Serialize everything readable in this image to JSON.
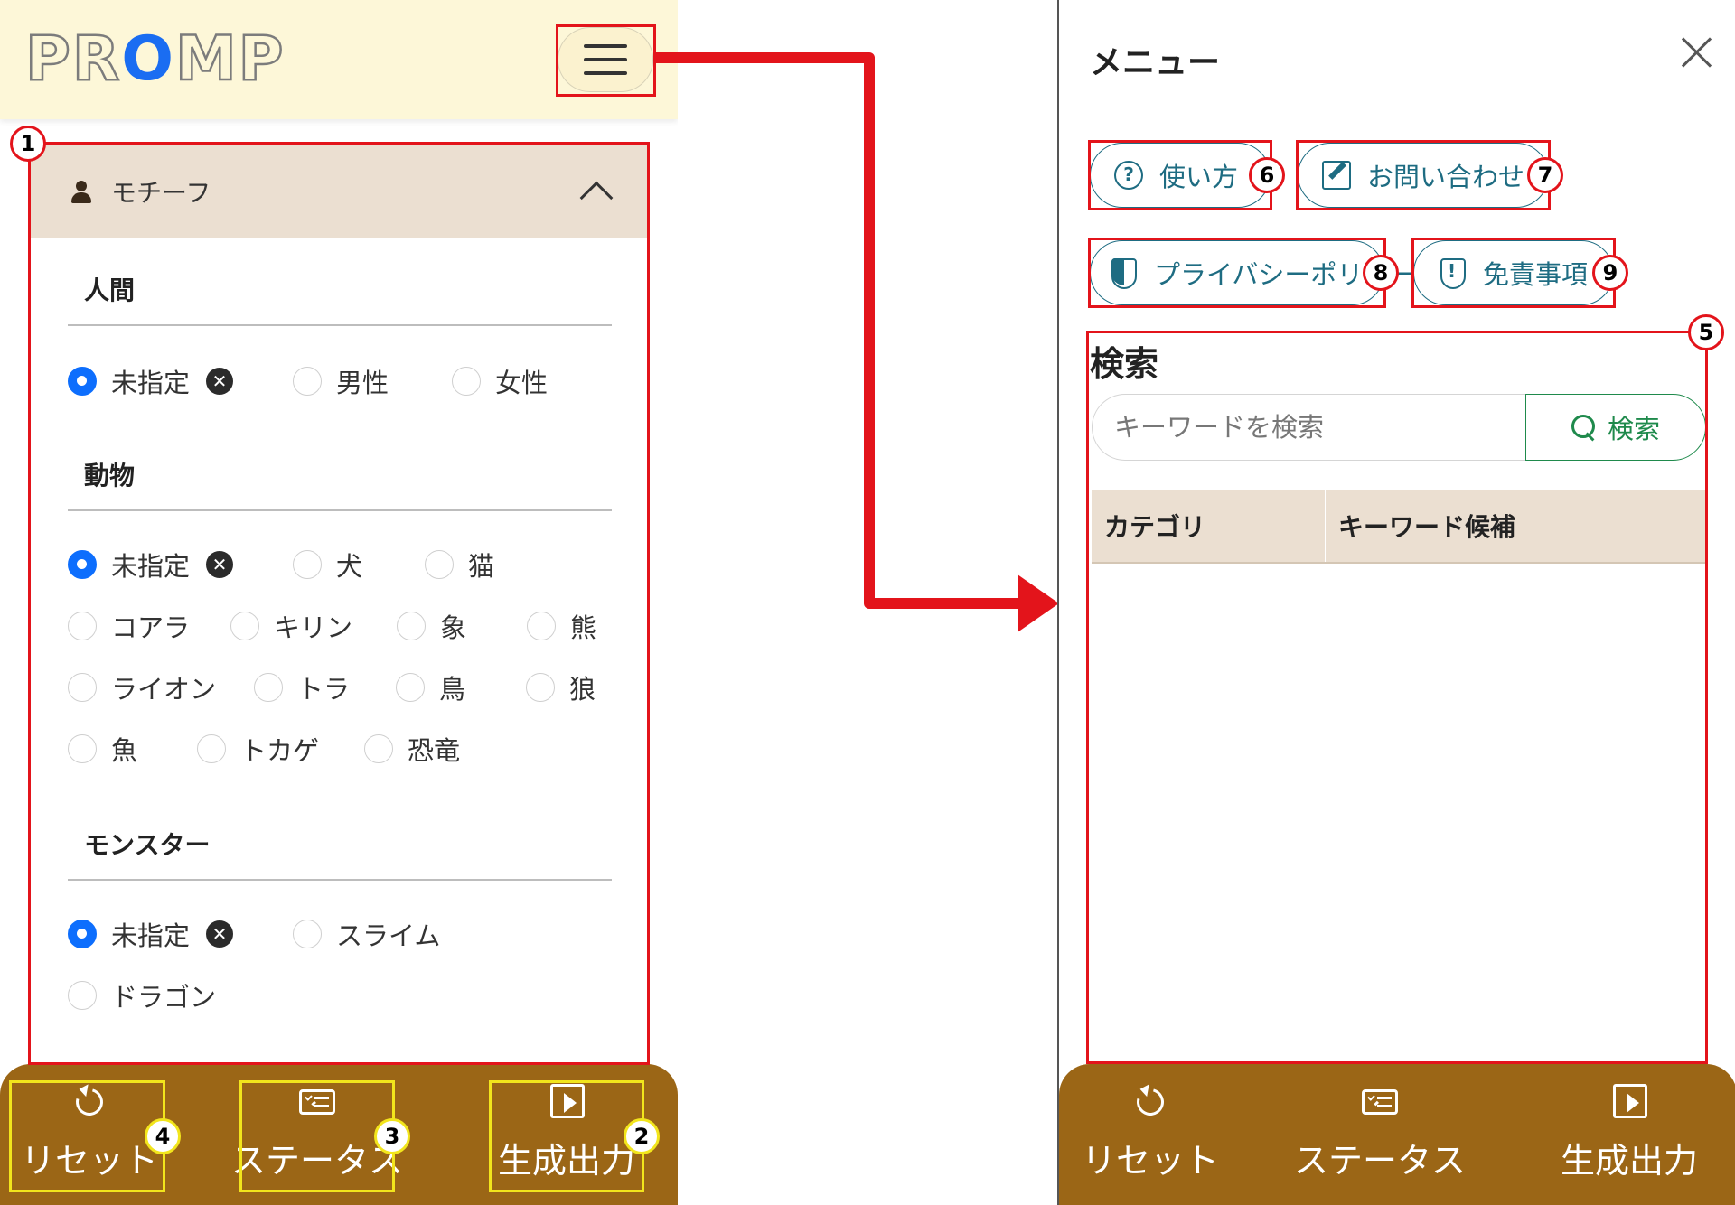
{
  "header": {
    "logo": "PROMP",
    "logo_pre": "PR",
    "logo_o": "O",
    "logo_post": "MP"
  },
  "motif": {
    "title": "モチーフ",
    "sections": [
      {
        "title": "人間",
        "options": [
          "未指定",
          "男性",
          "女性"
        ]
      },
      {
        "title": "動物",
        "options": [
          "未指定",
          "犬",
          "猫",
          "コアラ",
          "キリン",
          "象",
          "熊",
          "ライオン",
          "トラ",
          "鳥",
          "狼",
          "魚",
          "トカゲ",
          "恐竜"
        ]
      },
      {
        "title": "モンスター",
        "options": [
          "未指定",
          "スライム",
          "ドラゴン"
        ]
      }
    ],
    "clear_symbol": "✕"
  },
  "bottom_bar": {
    "reset": "リセット",
    "status": "ステータス",
    "generate": "生成出力"
  },
  "menu": {
    "title": "メニュー",
    "buttons": {
      "howto": "使い方",
      "contact": "お問い合わせ",
      "privacy": "プライバシーポリシー",
      "disclaimer": "免責事項"
    },
    "help_symbol": "?"
  },
  "search": {
    "title": "検索",
    "placeholder": "キーワードを検索",
    "button": "検索",
    "columns": [
      "カテゴリ",
      "キーワード候補"
    ]
  },
  "annotations": [
    "1",
    "2",
    "3",
    "4",
    "5",
    "6",
    "7",
    "8",
    "9"
  ],
  "colors": {
    "accent_blue": "#0d6efd",
    "brown_bar": "#9b6616",
    "header_bg": "#fdf7d8",
    "annot_red": "#e3141b",
    "annot_yellow": "#f2e51c",
    "teal": "#1e6c82",
    "green": "#1f8a4c"
  }
}
